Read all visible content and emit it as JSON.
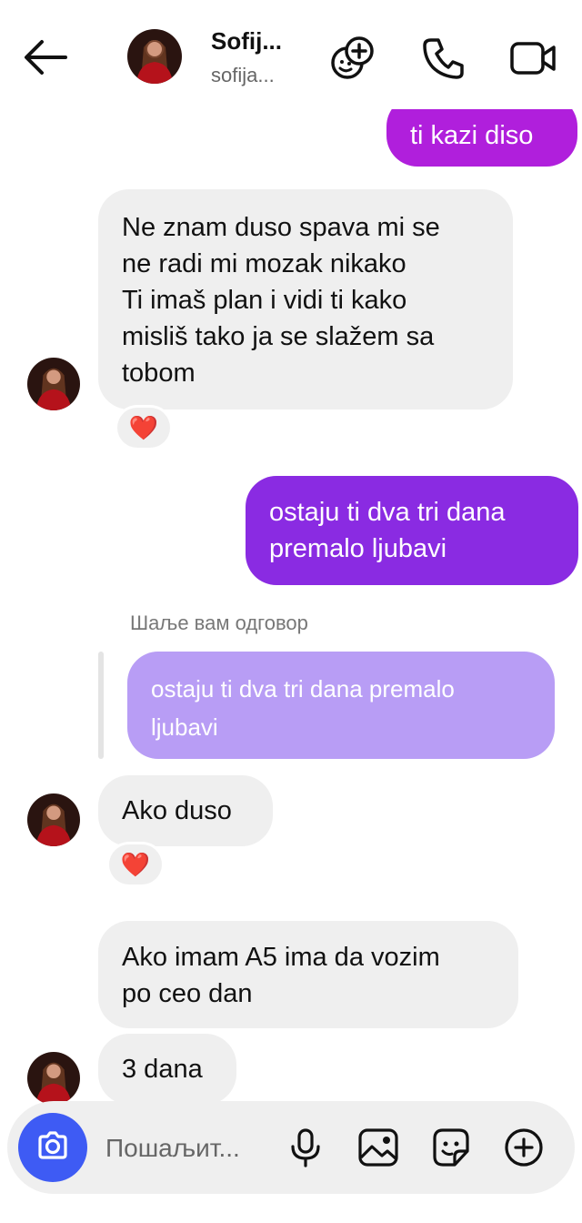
{
  "header": {
    "name": "Sofij...",
    "username": "sofija..."
  },
  "messages": [
    {
      "direction": "outgoing",
      "lines": [
        "ti kazi diso"
      ]
    },
    {
      "direction": "incoming",
      "lines": [
        "Ne znam duso spava mi se",
        "ne radi mi mozak nikako",
        "Ti imaš plan i vidi ti kako",
        "misliš tako ja se slažem sa",
        "tobom"
      ],
      "reaction": "❤️"
    },
    {
      "direction": "outgoing",
      "lines": [
        "ostaju ti dva tri dana",
        "premalo ljubavi"
      ]
    },
    {
      "direction": "incoming",
      "reply_label": "Шаље вам одговор",
      "reply_to_lines": [
        "ostaju ti dva tri dana premalo",
        "ljubavi"
      ],
      "lines": [
        "Ako duso"
      ],
      "reaction": "❤️"
    },
    {
      "direction": "incoming",
      "lines": [
        "Ako imam A5 ima da vozim",
        "po ceo dan"
      ]
    },
    {
      "direction": "incoming",
      "lines": [
        "3 dana"
      ]
    }
  ],
  "composer": {
    "placeholder": "Пошаљит..."
  },
  "colors": {
    "outgoing_top": "#b623e0",
    "outgoing_mid": "#8a2be2",
    "reply_quote": "#b89df5",
    "camera_button": "#3e5bf4",
    "incoming_bubble": "#efefef"
  },
  "icons": {
    "header": [
      "back-arrow-icon",
      "add-effects-icon",
      "phone-icon",
      "video-camera-icon"
    ],
    "composer": [
      "camera-icon",
      "microphone-icon",
      "gallery-icon",
      "sticker-icon",
      "add-icon"
    ]
  }
}
